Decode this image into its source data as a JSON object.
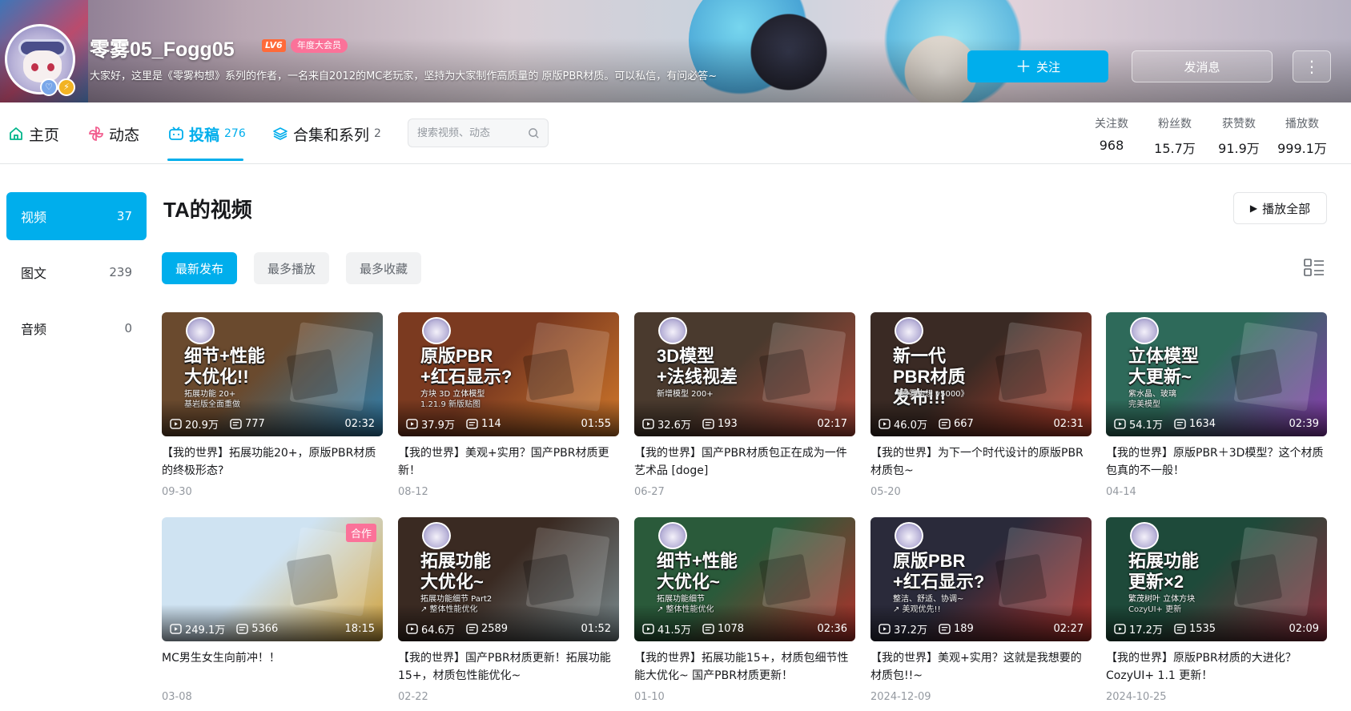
{
  "profile": {
    "name": "零雾05_Fogg05",
    "level": "LV6",
    "vip": "年度大会员",
    "sign": "大家好，这里是《零雾构想》系列的作者，一名来自2012的MC老玩家，坚持为大家制作高质量的 原版PBR材质。可以私信，有问必答~",
    "follow_label": "关注",
    "message_label": "发消息",
    "more_label": "⋮"
  },
  "nav": {
    "tabs": [
      {
        "label": "主页",
        "count": ""
      },
      {
        "label": "动态",
        "count": ""
      },
      {
        "label": "投稿",
        "count": "276"
      },
      {
        "label": "合集和系列",
        "count": "2"
      }
    ],
    "search_placeholder": "搜索视频、动态",
    "stats": [
      {
        "label": "关注数",
        "value": "968"
      },
      {
        "label": "粉丝数",
        "value": "15.7万"
      },
      {
        "label": "获赞数",
        "value": "91.9万"
      },
      {
        "label": "播放数",
        "value": "999.1万"
      }
    ]
  },
  "sidebar": {
    "items": [
      {
        "label": "视频",
        "count": "37"
      },
      {
        "label": "图文",
        "count": "239"
      },
      {
        "label": "音频",
        "count": "0"
      }
    ]
  },
  "main": {
    "title": "TA的视频",
    "play_all": "播放全部",
    "orders": [
      "最新发布",
      "最多播放",
      "最多收藏"
    ]
  },
  "videos": [
    {
      "caption": "细节+性能\n大优化!!",
      "sub": "拓展功能 20+\n基岩版全面重做",
      "views": "20.9万",
      "danmaku": "777",
      "duration": "02:32",
      "title": "【我的世界】拓展功能20+，原版PBR材质的终极形态?",
      "date": "09-30",
      "bg": "#6a4a2e",
      "bg2": "#2f7fae"
    },
    {
      "caption": "原版PBR\n+红石显示?",
      "sub": "方块 3D 立体模型\n1.21.9 新版贴图",
      "views": "37.9万",
      "danmaku": "114",
      "duration": "01:55",
      "title": "【我的世界】美观+实用？国产PBR材质更新！",
      "date": "08-12",
      "bg": "#7b3a20",
      "bg2": "#d1782a"
    },
    {
      "caption": "3D模型\n+法线视差",
      "sub": "新增模型 200+",
      "views": "32.6万",
      "danmaku": "193",
      "duration": "02:17",
      "title": "【我的世界】国产PBR材质包正在成为一件艺术品 [doge]",
      "date": "06-27",
      "bg": "#4a3a2e",
      "bg2": "#b44a3a"
    },
    {
      "caption": "新一代\nPBR材质\n发布!!!",
      "sub": "《零雾构想 v5000》",
      "views": "46.0万",
      "danmaku": "667",
      "duration": "02:31",
      "title": "【我的世界】为下一个时代设计的原版PBR材质包~",
      "date": "05-20",
      "bg": "#3a2a24",
      "bg2": "#c2412c"
    },
    {
      "caption": "立体模型\n大更新~",
      "sub": "紫水晶、玻璃\n完美模型",
      "views": "54.1万",
      "danmaku": "1634",
      "duration": "02:39",
      "title": "【我的世界】原版PBR＋3D模型？这个材质包真的不一般！",
      "date": "04-14",
      "bg": "#2e6a5a",
      "bg2": "#8a3ab0"
    },
    {
      "caption": "",
      "sub": "",
      "views": "249.1万",
      "danmaku": "5366",
      "duration": "18:15",
      "title": "MC男生女生向前冲！！",
      "date": "03-08",
      "bg": "#cfe3f2",
      "bg2": "#d2a23a",
      "collab": "合作"
    },
    {
      "caption": "拓展功能\n大优化~",
      "sub": "拓展功能细节 Part2\n↗ 整体性能优化",
      "views": "64.6万",
      "danmaku": "2589",
      "duration": "01:52",
      "title": "【我的世界】国产PBR材质更新！拓展功能15+，材质包性能优化~",
      "date": "02-22",
      "bg": "#3a2a22",
      "bg2": "#7a8a8e"
    },
    {
      "caption": "细节+性能\n大优化~",
      "sub": "拓展功能细节\n↗ 整体性能优化",
      "views": "41.5万",
      "danmaku": "1078",
      "duration": "02:36",
      "title": "【我的世界】拓展功能15+，材质包细节性能大优化~ 国产PBR材质更新！",
      "date": "01-10",
      "bg": "#2a5a3a",
      "bg2": "#b0302a"
    },
    {
      "caption": "原版PBR\n+红石显示?",
      "sub": "整洁、舒适、协调~\n↗ 美观优先!!",
      "views": "37.2万",
      "danmaku": "189",
      "duration": "02:27",
      "title": "【我的世界】美观+实用？这就是我想要的材质包!!~",
      "date": "2024-12-09",
      "bg": "#2a2a3a",
      "bg2": "#b0302a"
    },
    {
      "caption": "拓展功能\n更新×2",
      "sub": "繁茂树叶 立体方块\nCozyUI+ 更新",
      "views": "17.2万",
      "danmaku": "1535",
      "duration": "02:09",
      "title": "【我的世界】原版PBR材质的大进化？CozyUI+ 1.1 更新！",
      "date": "2024-10-25",
      "bg": "#1e4a3a",
      "bg2": "#8a2a3a"
    }
  ]
}
